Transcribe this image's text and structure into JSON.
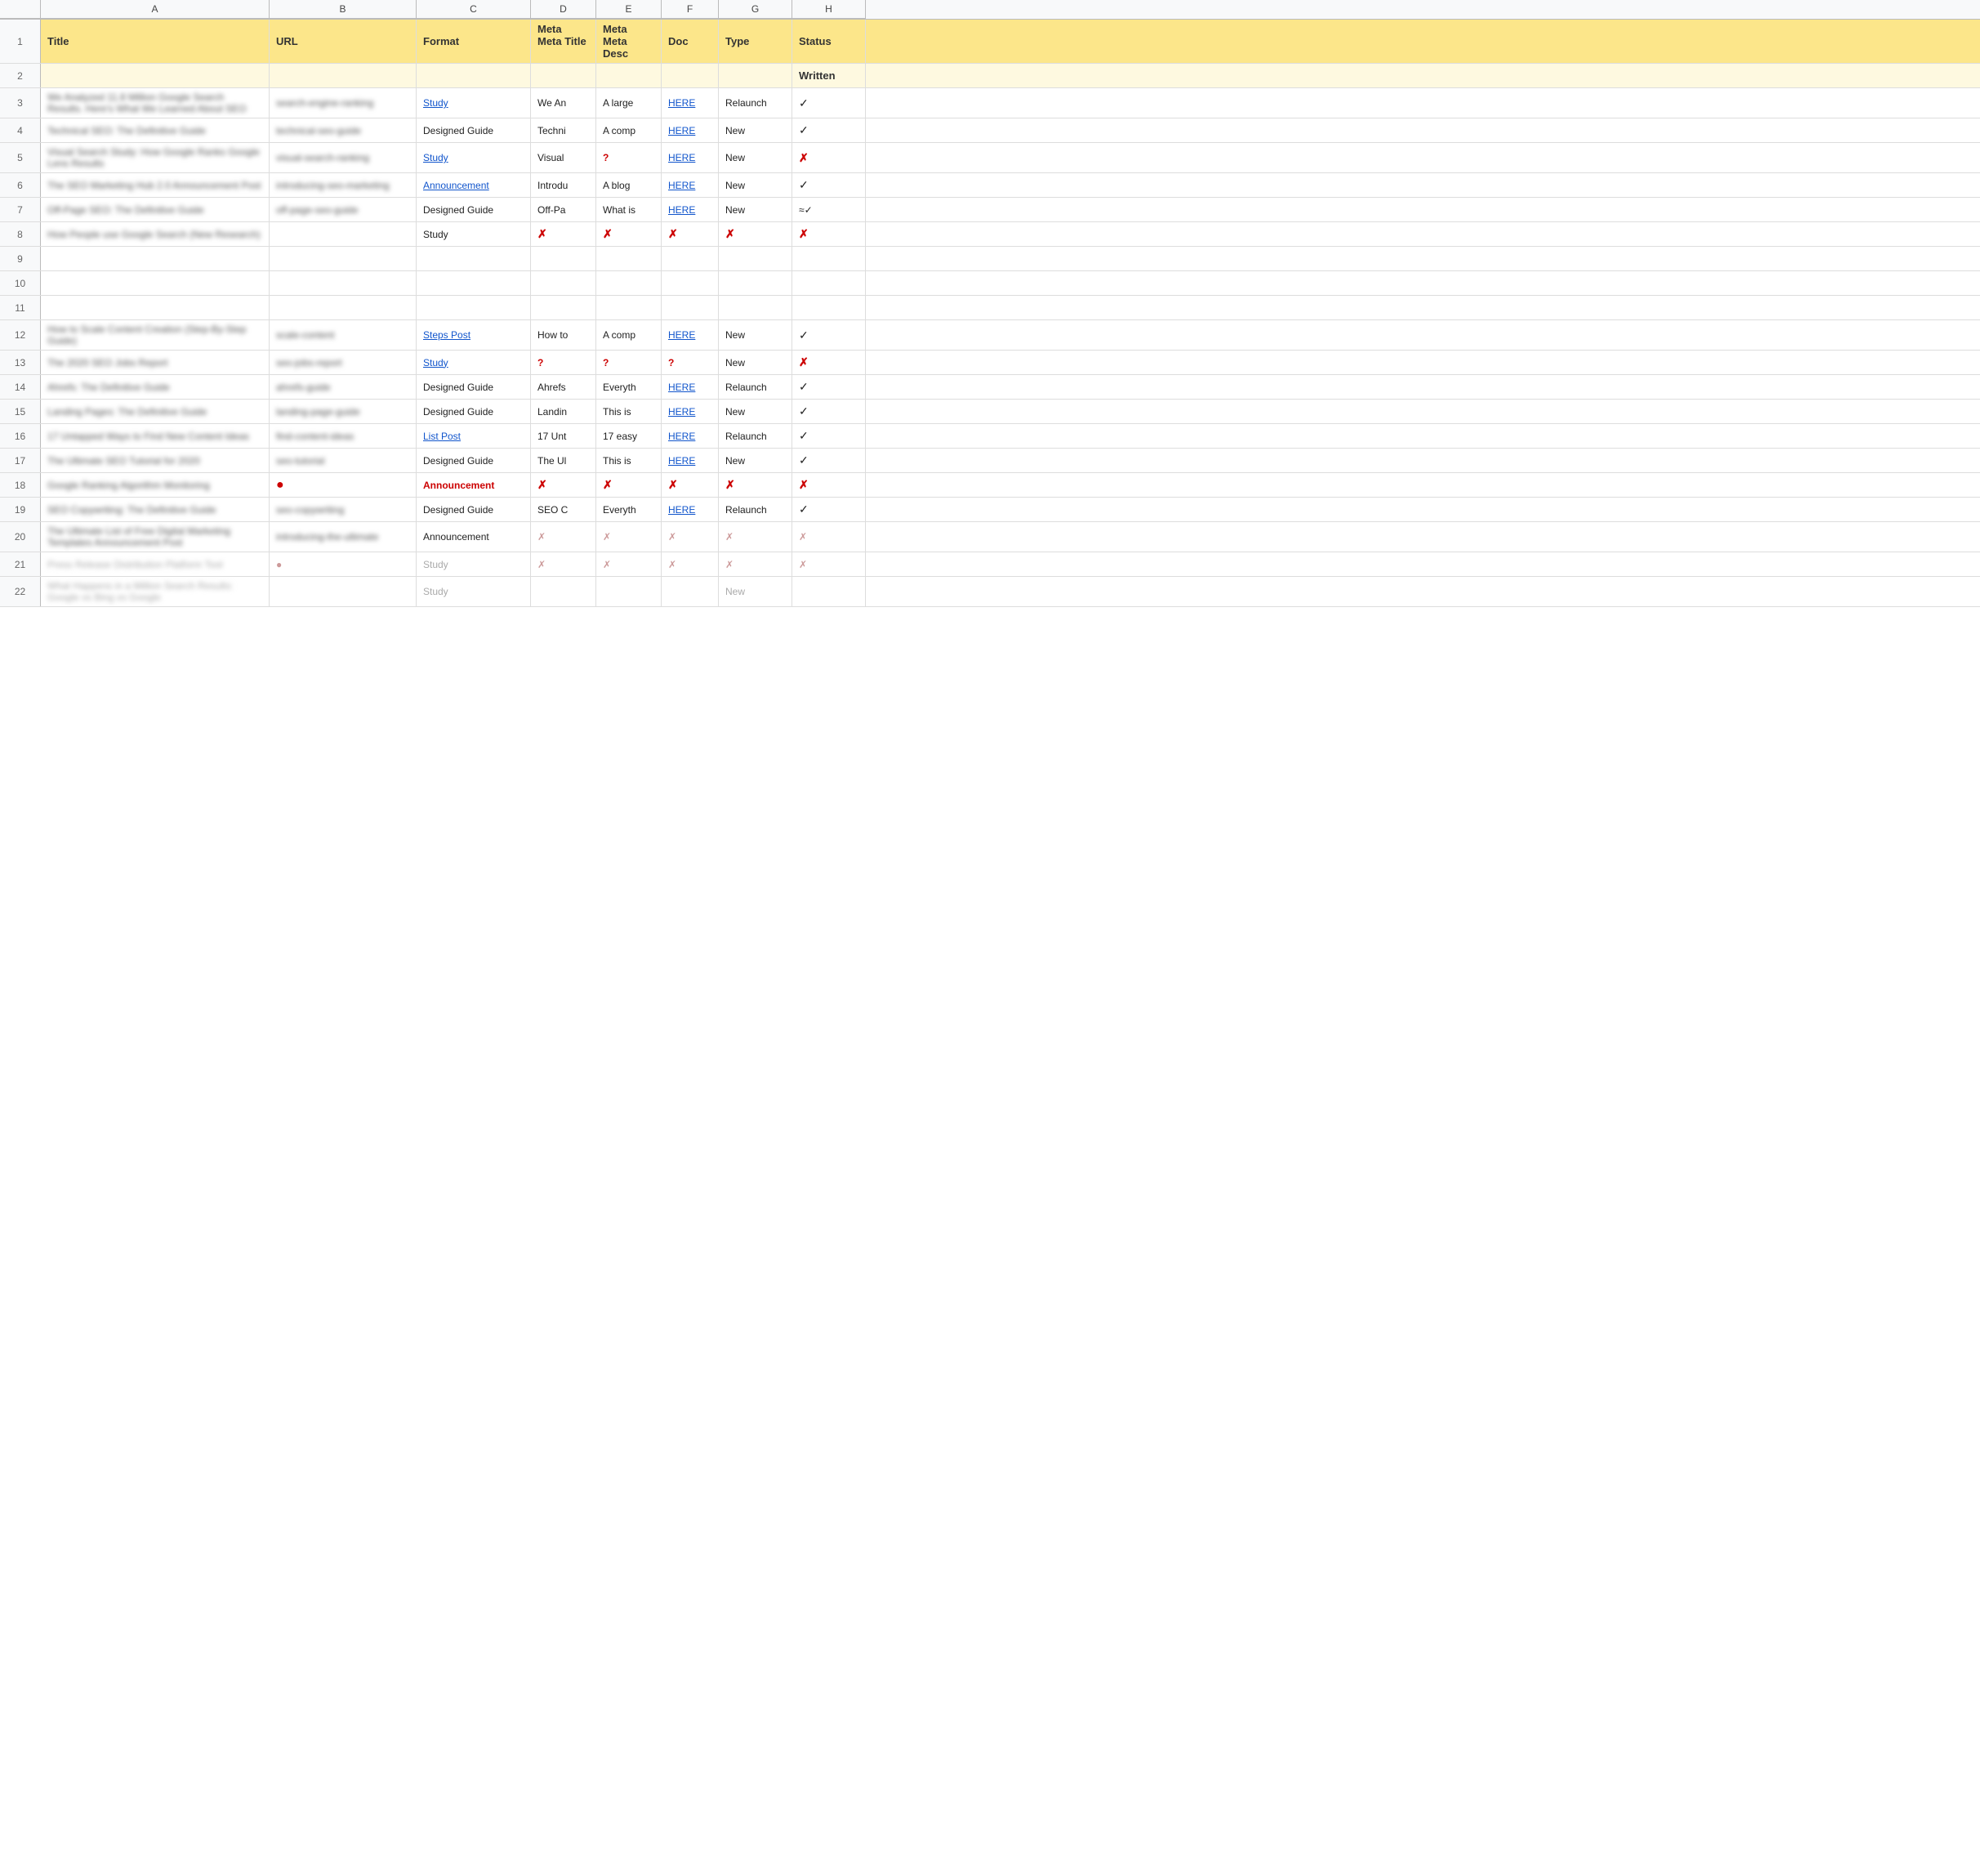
{
  "columns": {
    "letters": [
      "A",
      "B",
      "C",
      "D",
      "E",
      "F",
      "G",
      "H"
    ],
    "headers": {
      "row1": {
        "a": "Title",
        "b": "URL",
        "c": "Format",
        "d": "Meta Title",
        "e": "Meta Desc",
        "f": "Doc",
        "g": "Type",
        "h": "Status"
      },
      "row2": {
        "h": "Written"
      }
    }
  },
  "rows": [
    {
      "num": 3,
      "style": "normal",
      "a": "We Analyzed 11.8 Million Google Search Results. Here's What We Learned About SEO",
      "b": "search-engine-ranking",
      "c_link": "Study",
      "c_is_link": true,
      "d": "We An",
      "e": "A large",
      "f_link": "HERE",
      "f_is_link": true,
      "g": "Relaunch",
      "h": "✓",
      "h_type": "check"
    },
    {
      "num": 4,
      "style": "normal",
      "a": "Technical SEO: The Definitive Guide",
      "b": "technical-seo-guide",
      "c": "Designed Guide",
      "c_is_link": false,
      "d": "Techni",
      "e": "A comp",
      "f_link": "HERE",
      "f_is_link": true,
      "g": "New",
      "h": "✓",
      "h_type": "check"
    },
    {
      "num": 5,
      "style": "normal",
      "a": "Visual Search Study: How Google Ranks Google Lens Results",
      "b": "visual-search-ranking",
      "c_link": "Study",
      "c_is_link": true,
      "d": "Visual",
      "e_type": "question_red",
      "e": "?",
      "f_link": "HERE",
      "f_is_link": true,
      "g": "New",
      "h_type": "red_x",
      "h": "✗"
    },
    {
      "num": 6,
      "style": "normal",
      "a": "The SEO Marketing Hub 2.0 Announcement Post",
      "b": "introducing-seo-marketing",
      "c_link": "Announcement",
      "c_is_link": true,
      "d": "Introdu",
      "e": "A blog",
      "f_link": "HERE",
      "f_is_link": true,
      "g": "New",
      "h": "✓",
      "h_type": "check"
    },
    {
      "num": 7,
      "style": "normal",
      "a": "Off-Page SEO: The Definitive Guide",
      "b": "off-page-seo-guide",
      "c": "Designed Guide",
      "c_is_link": false,
      "d": "Off-Pa",
      "e": "What is",
      "f_link": "HERE",
      "f_is_link": true,
      "g": "New",
      "h": "≈✓",
      "h_type": "approx"
    },
    {
      "num": 8,
      "style": "normal",
      "a": "How People use Google Search (New Research)",
      "b": "",
      "c": "Study",
      "c_is_link": false,
      "d_type": "red_x",
      "d": "✗",
      "e_type": "red_x",
      "e": "✗",
      "f_type": "red_x",
      "f": "✗",
      "g_type": "red_x",
      "g": "✗",
      "h_type": "red_x",
      "h": "✗"
    },
    {
      "num": 9,
      "style": "empty"
    },
    {
      "num": 10,
      "style": "empty"
    },
    {
      "num": 11,
      "style": "empty"
    },
    {
      "num": 12,
      "style": "normal",
      "a": "How to Scale Content Creation (Step-By-Step Guide)",
      "b": "scale-content",
      "c_link": "Steps Post",
      "c_is_link": true,
      "d": "How to",
      "e": "A comp",
      "f_link": "HERE",
      "f_is_link": true,
      "g": "New",
      "h": "✓",
      "h_type": "check"
    },
    {
      "num": 13,
      "style": "normal",
      "a": "The 2020 SEO Jobs Report",
      "b": "seo-jobs-report",
      "c_link": "Study",
      "c_is_link": true,
      "d_type": "question_red",
      "d": "?",
      "e_type": "question_red",
      "e": "?",
      "f_type": "question_red",
      "f": "?",
      "g": "New",
      "h_type": "red_x",
      "h": "✗"
    },
    {
      "num": 14,
      "style": "normal",
      "a": "Ahrefs: The Definitive Guide",
      "b": "ahrefs-guide",
      "c": "Designed Guide",
      "c_is_link": false,
      "d": "Ahrefs",
      "e": "Everyth",
      "f_link": "HERE",
      "f_is_link": true,
      "g": "Relaunch",
      "h": "✓",
      "h_type": "check"
    },
    {
      "num": 15,
      "style": "normal",
      "a": "Landing Pages: The Definitive Guide",
      "b": "landing-page-guide",
      "c": "Designed Guide",
      "c_is_link": false,
      "d": "Landin",
      "e": "This is",
      "f_link": "HERE",
      "f_is_link": true,
      "g": "New",
      "h": "✓",
      "h_type": "check"
    },
    {
      "num": 16,
      "style": "normal",
      "a": "17 Untapped Ways to Find New Content Ideas",
      "b": "find-content-ideas",
      "c_link": "List Post",
      "c_is_link": true,
      "d": "17 Unt",
      "e": "17 easy",
      "f_link": "HERE",
      "f_is_link": true,
      "g": "Relaunch",
      "h": "✓",
      "h_type": "check"
    },
    {
      "num": 17,
      "style": "normal",
      "a": "The Ultimate SEO Tutorial for 2020",
      "b": "seo-tutorial",
      "c": "Designed Guide",
      "c_is_link": false,
      "d": "The Ul",
      "e": "This is",
      "f_link": "HERE",
      "f_is_link": true,
      "g": "New",
      "h": "✓",
      "h_type": "check"
    },
    {
      "num": 18,
      "style": "normal",
      "a": "Google Ranking Algorithm Monitoring",
      "b_type": "red_dot",
      "b": "●",
      "c_type": "red_bold",
      "c": "Announcement",
      "c_is_link": false,
      "d_type": "red_x",
      "d": "✗",
      "e_type": "red_x",
      "e": "✗",
      "f_type": "red_x",
      "f": "✗",
      "g_type": "red_x",
      "g": "✗",
      "h_type": "red_x",
      "h": "✗"
    },
    {
      "num": 19,
      "style": "normal",
      "a": "SEO Copywriting: The Definitive Guide",
      "b": "seo-copywriting",
      "c": "Designed Guide",
      "c_is_link": false,
      "d": "SEO C",
      "e": "Everyth",
      "f_link": "HERE",
      "f_is_link": true,
      "g": "Relaunch",
      "h": "✓",
      "h_type": "check"
    },
    {
      "num": 20,
      "style": "normal",
      "a": "The Ultimate List of Free Digital Marketing Templates Announcement Post",
      "b": "introducing-the-ultimate",
      "c": "Announcement",
      "c_is_link": false,
      "d_type": "faded_x",
      "d": "✗",
      "e_type": "faded_x",
      "e": "✗",
      "f_type": "faded_x",
      "f": "✗",
      "g_type": "faded_x",
      "g": "✗",
      "h_type": "faded_x",
      "h": "✗"
    },
    {
      "num": 21,
      "style": "faded",
      "a": "Press Release Distribution Platform Tool",
      "b_type": "red_dot",
      "b": "●",
      "c": "Study",
      "c_is_link": false,
      "d_type": "faded_x",
      "d": "✗",
      "e_type": "faded_x",
      "e": "✗",
      "f_type": "faded_x",
      "f": "✗",
      "g_type": "faded_x",
      "g": "✗",
      "h_type": "faded_x",
      "h": "✗"
    },
    {
      "num": 22,
      "style": "faded",
      "a": "What Happens in a Million Search Results: Google vs Bing vs Google",
      "b": "",
      "c": "Study",
      "c_is_link": false,
      "d": "",
      "e": "",
      "f": "",
      "g": "New",
      "h": "",
      "h_type": "normal"
    }
  ],
  "colors": {
    "header_bg": "#fce68a",
    "row2_bg": "#fef9e0",
    "link_color": "#1155CC",
    "red": "#cc0000",
    "check": "#222222",
    "col_header_bg": "#f8f9fa"
  }
}
